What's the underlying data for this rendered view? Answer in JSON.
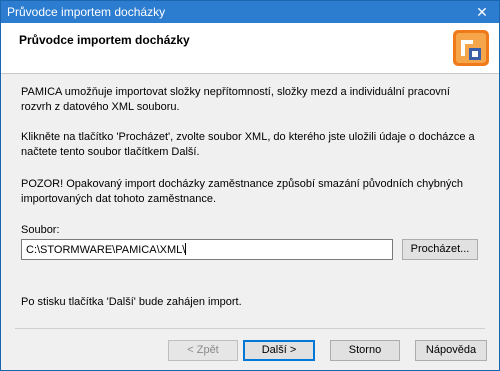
{
  "window": {
    "title": "Průvodce importem docházky",
    "close_glyph": "✕"
  },
  "header": {
    "title": "Průvodce importem docházky",
    "logo_icon": "pamica-logo-icon"
  },
  "content": {
    "paragraph1": "PAMICA umožňuje importovat složky nepřítomností, složky mezd a individuální pracovní rozvrh z datového XML souboru.",
    "paragraph2": "Klikněte na tlačítko 'Procházet', zvolte soubor XML, do kterého jste uložili údaje o docházce a načtete tento soubor tlačítkem Další.",
    "paragraph3": "POZOR! Opakovaný import docházky zaměstnance způsobí smazání původních chybných importovaných dat tohoto zaměstnance.",
    "file_label": "Soubor:",
    "file_value": "C:\\STORMWARE\\PAMICA\\XML\\",
    "browse_label": "Procházet...",
    "footer_note": "Po stisku tlačítka 'Další' bude zahájen import."
  },
  "buttons": {
    "back": "< Zpět",
    "next": "Další >",
    "cancel": "Storno",
    "help": "Nápověda"
  },
  "colors": {
    "titlebar": "#2c7cd0",
    "accent": "#0078d7",
    "dialog_bg": "#f0f0f0"
  }
}
